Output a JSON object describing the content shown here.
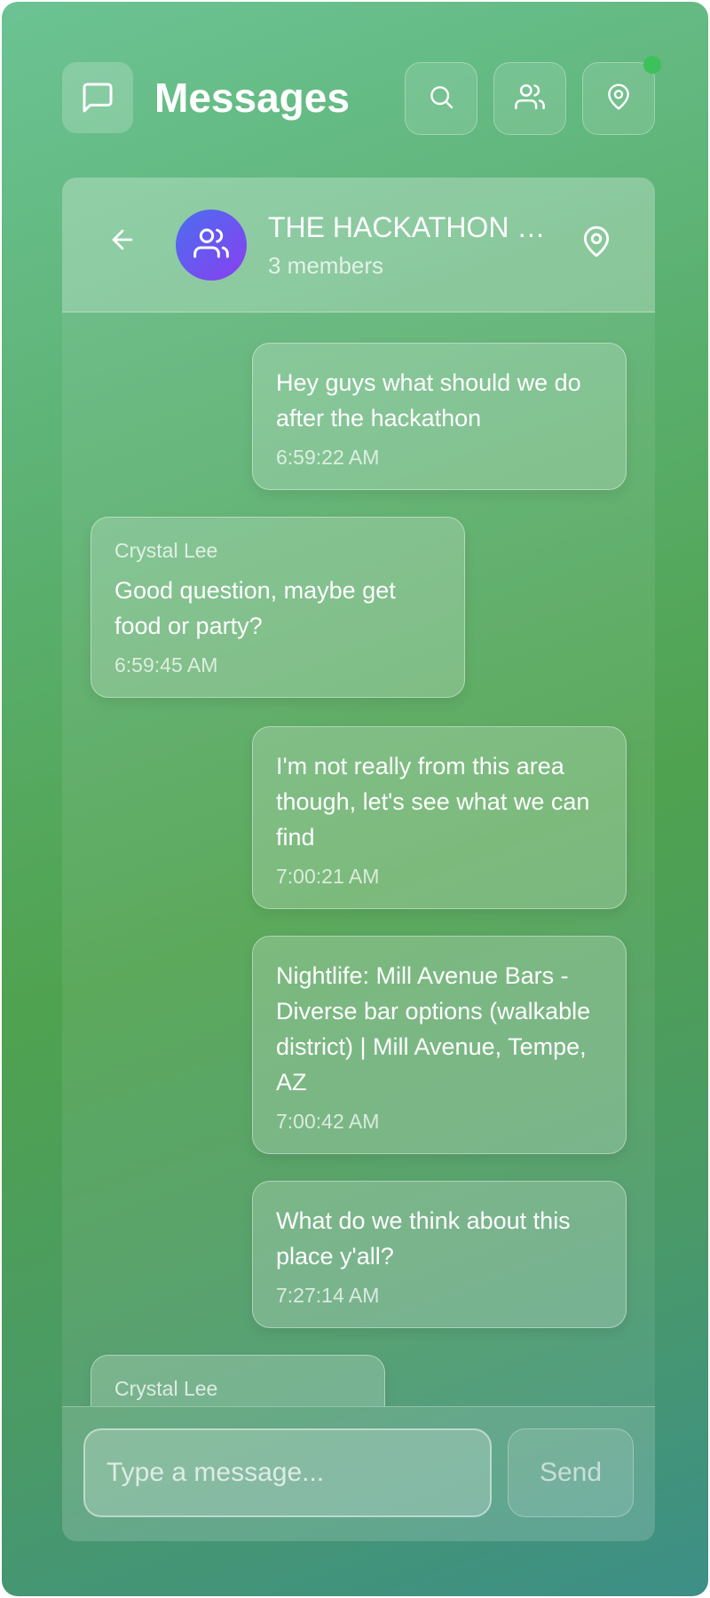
{
  "header": {
    "title": "Messages",
    "icons": [
      "message-square-icon",
      "search-icon",
      "users-icon",
      "map-pin-icon"
    ],
    "online_color": "#3dc15a"
  },
  "chat": {
    "name": "THE HACKATHON …",
    "members": "3 members",
    "avatar_icon": "users-icon"
  },
  "messages": [
    {
      "direction": "out",
      "sender": "",
      "text": "Hey guys what should we do after the hackathon",
      "time": "6:59:22 AM"
    },
    {
      "direction": "in",
      "sender": "Crystal Lee",
      "text": "Good question, maybe get food or party?",
      "time": "6:59:45 AM"
    },
    {
      "direction": "out",
      "sender": "",
      "text": "I'm not really from this area though, let's see what we can find",
      "time": "7:00:21 AM"
    },
    {
      "direction": "out",
      "sender": "",
      "text": "Nightlife: Mill Avenue Bars - Diverse bar options (walkable district) | Mill Avenue, Tempe, AZ",
      "time": "7:00:42 AM"
    },
    {
      "direction": "out",
      "sender": "",
      "text": "What do we think about this place y'all?",
      "time": "7:27:14 AM"
    },
    {
      "direction": "in",
      "sender": "Crystal Lee",
      "text": "",
      "time": ""
    }
  ],
  "composer": {
    "placeholder": "Type a message...",
    "send_label": "Send"
  }
}
